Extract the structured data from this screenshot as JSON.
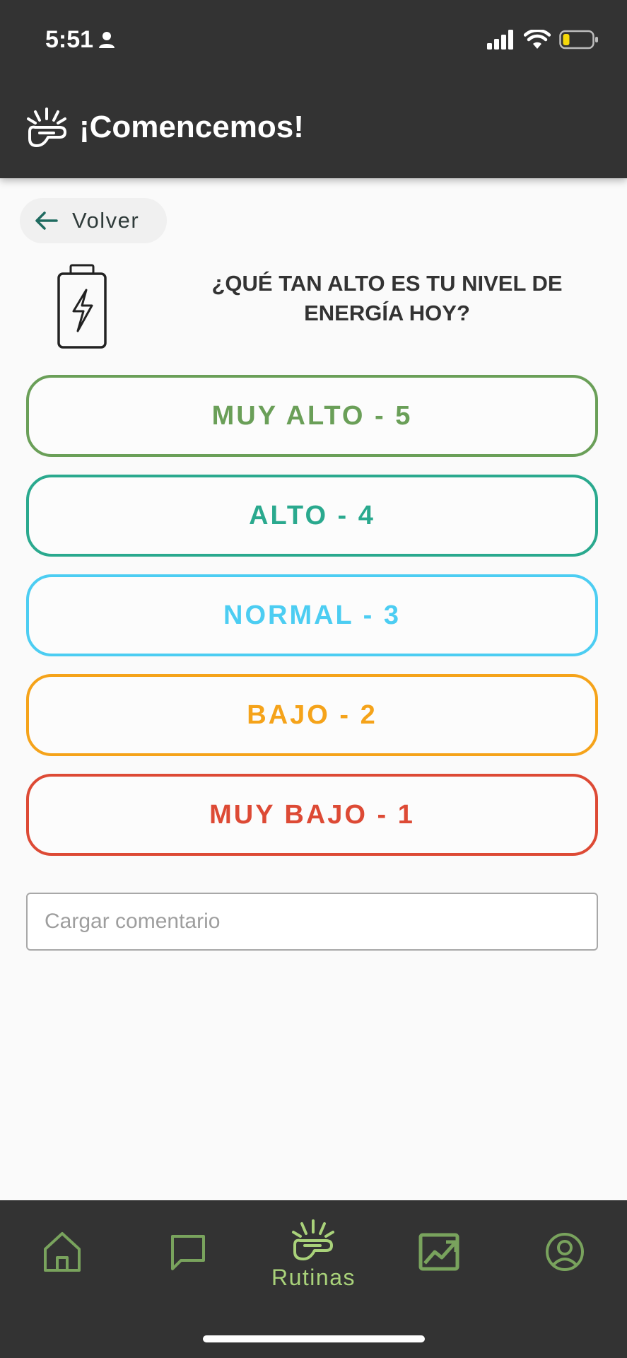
{
  "status_bar": {
    "time": "5:51",
    "icons": [
      "person-icon",
      "signal-icon",
      "wifi-icon",
      "battery-low-icon"
    ]
  },
  "header": {
    "title": "¡Comencemos!",
    "icon": "pipe-sparkle-icon"
  },
  "back": {
    "label": "Volver",
    "icon": "arrow-left-icon"
  },
  "question": {
    "icon": "battery-bolt-icon",
    "text": "¿QUÉ TAN ALTO ES TU NIVEL DE ENERGÍA HOY?"
  },
  "options": [
    {
      "label": "MUY ALTO - 5",
      "color": "#6a9f58"
    },
    {
      "label": "ALTO - 4",
      "color": "#2aa98e"
    },
    {
      "label": "NORMAL - 3",
      "color": "#4ccdf2"
    },
    {
      "label": "BAJO - 2",
      "color": "#f5a31a"
    },
    {
      "label": "MUY BAJO - 1",
      "color": "#dd4a35"
    }
  ],
  "comment": {
    "placeholder": "Cargar comentario",
    "value": ""
  },
  "bottom_nav": {
    "items": [
      {
        "name": "home",
        "icon": "home-icon",
        "label": ""
      },
      {
        "name": "chat",
        "icon": "chat-icon",
        "label": ""
      },
      {
        "name": "routines",
        "icon": "pipe-sparkle-icon",
        "label": "Rutinas",
        "active": true
      },
      {
        "name": "stats",
        "icon": "trend-chart-icon",
        "label": ""
      },
      {
        "name": "profile",
        "icon": "profile-icon",
        "label": ""
      }
    ]
  },
  "colors": {
    "bar_background": "#333333",
    "nav_icon": "#79a35d",
    "nav_active": "#a9d27a",
    "accent_dark": "#1f6b60"
  }
}
